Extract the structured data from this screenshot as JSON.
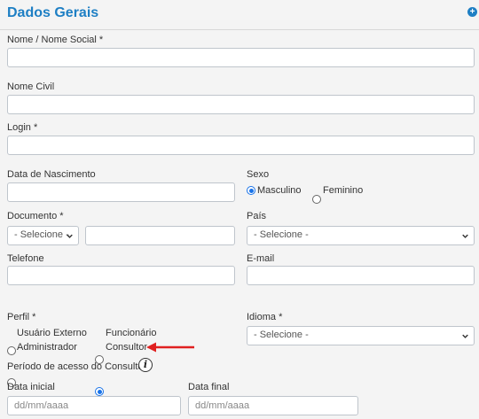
{
  "section": {
    "title": "Dados Gerais",
    "expand_icon": "plus-circle-icon"
  },
  "fields": {
    "nome": {
      "label": "Nome / Nome Social *",
      "value": ""
    },
    "nome_civil": {
      "label": "Nome Civil",
      "value": ""
    },
    "login": {
      "label": "Login *",
      "value": ""
    },
    "nascimento": {
      "label": "Data de Nascimento",
      "value": ""
    },
    "sexo": {
      "label": "Sexo",
      "options": [
        "Masculino",
        "Feminino"
      ],
      "selected": "Masculino"
    },
    "documento": {
      "label": "Documento *",
      "select_value": "- Selecione -",
      "number_value": ""
    },
    "pais": {
      "label": "País",
      "select_value": "- Selecione -"
    },
    "telefone": {
      "label": "Telefone",
      "value": ""
    },
    "email": {
      "label": "E-mail",
      "value": ""
    },
    "perfil": {
      "label": "Perfil *",
      "options": [
        "Usuário Externo",
        "Funcionário",
        "Administrador",
        "Consultor"
      ],
      "selected": "Consultor"
    },
    "idioma": {
      "label": "Idioma *",
      "select_value": "- Selecione -"
    },
    "periodo": {
      "label": "Período de acesso do Consultor",
      "info_icon": "info-icon"
    },
    "data_inicial": {
      "label": "Data inicial",
      "placeholder": "dd/mm/aaaa"
    },
    "data_final": {
      "label": "Data final",
      "placeholder": "dd/mm/aaaa"
    }
  },
  "colors": {
    "accent": "#1e7fc4",
    "radio_selected": "#1a73e8",
    "annotation_arrow": "#e02020"
  }
}
